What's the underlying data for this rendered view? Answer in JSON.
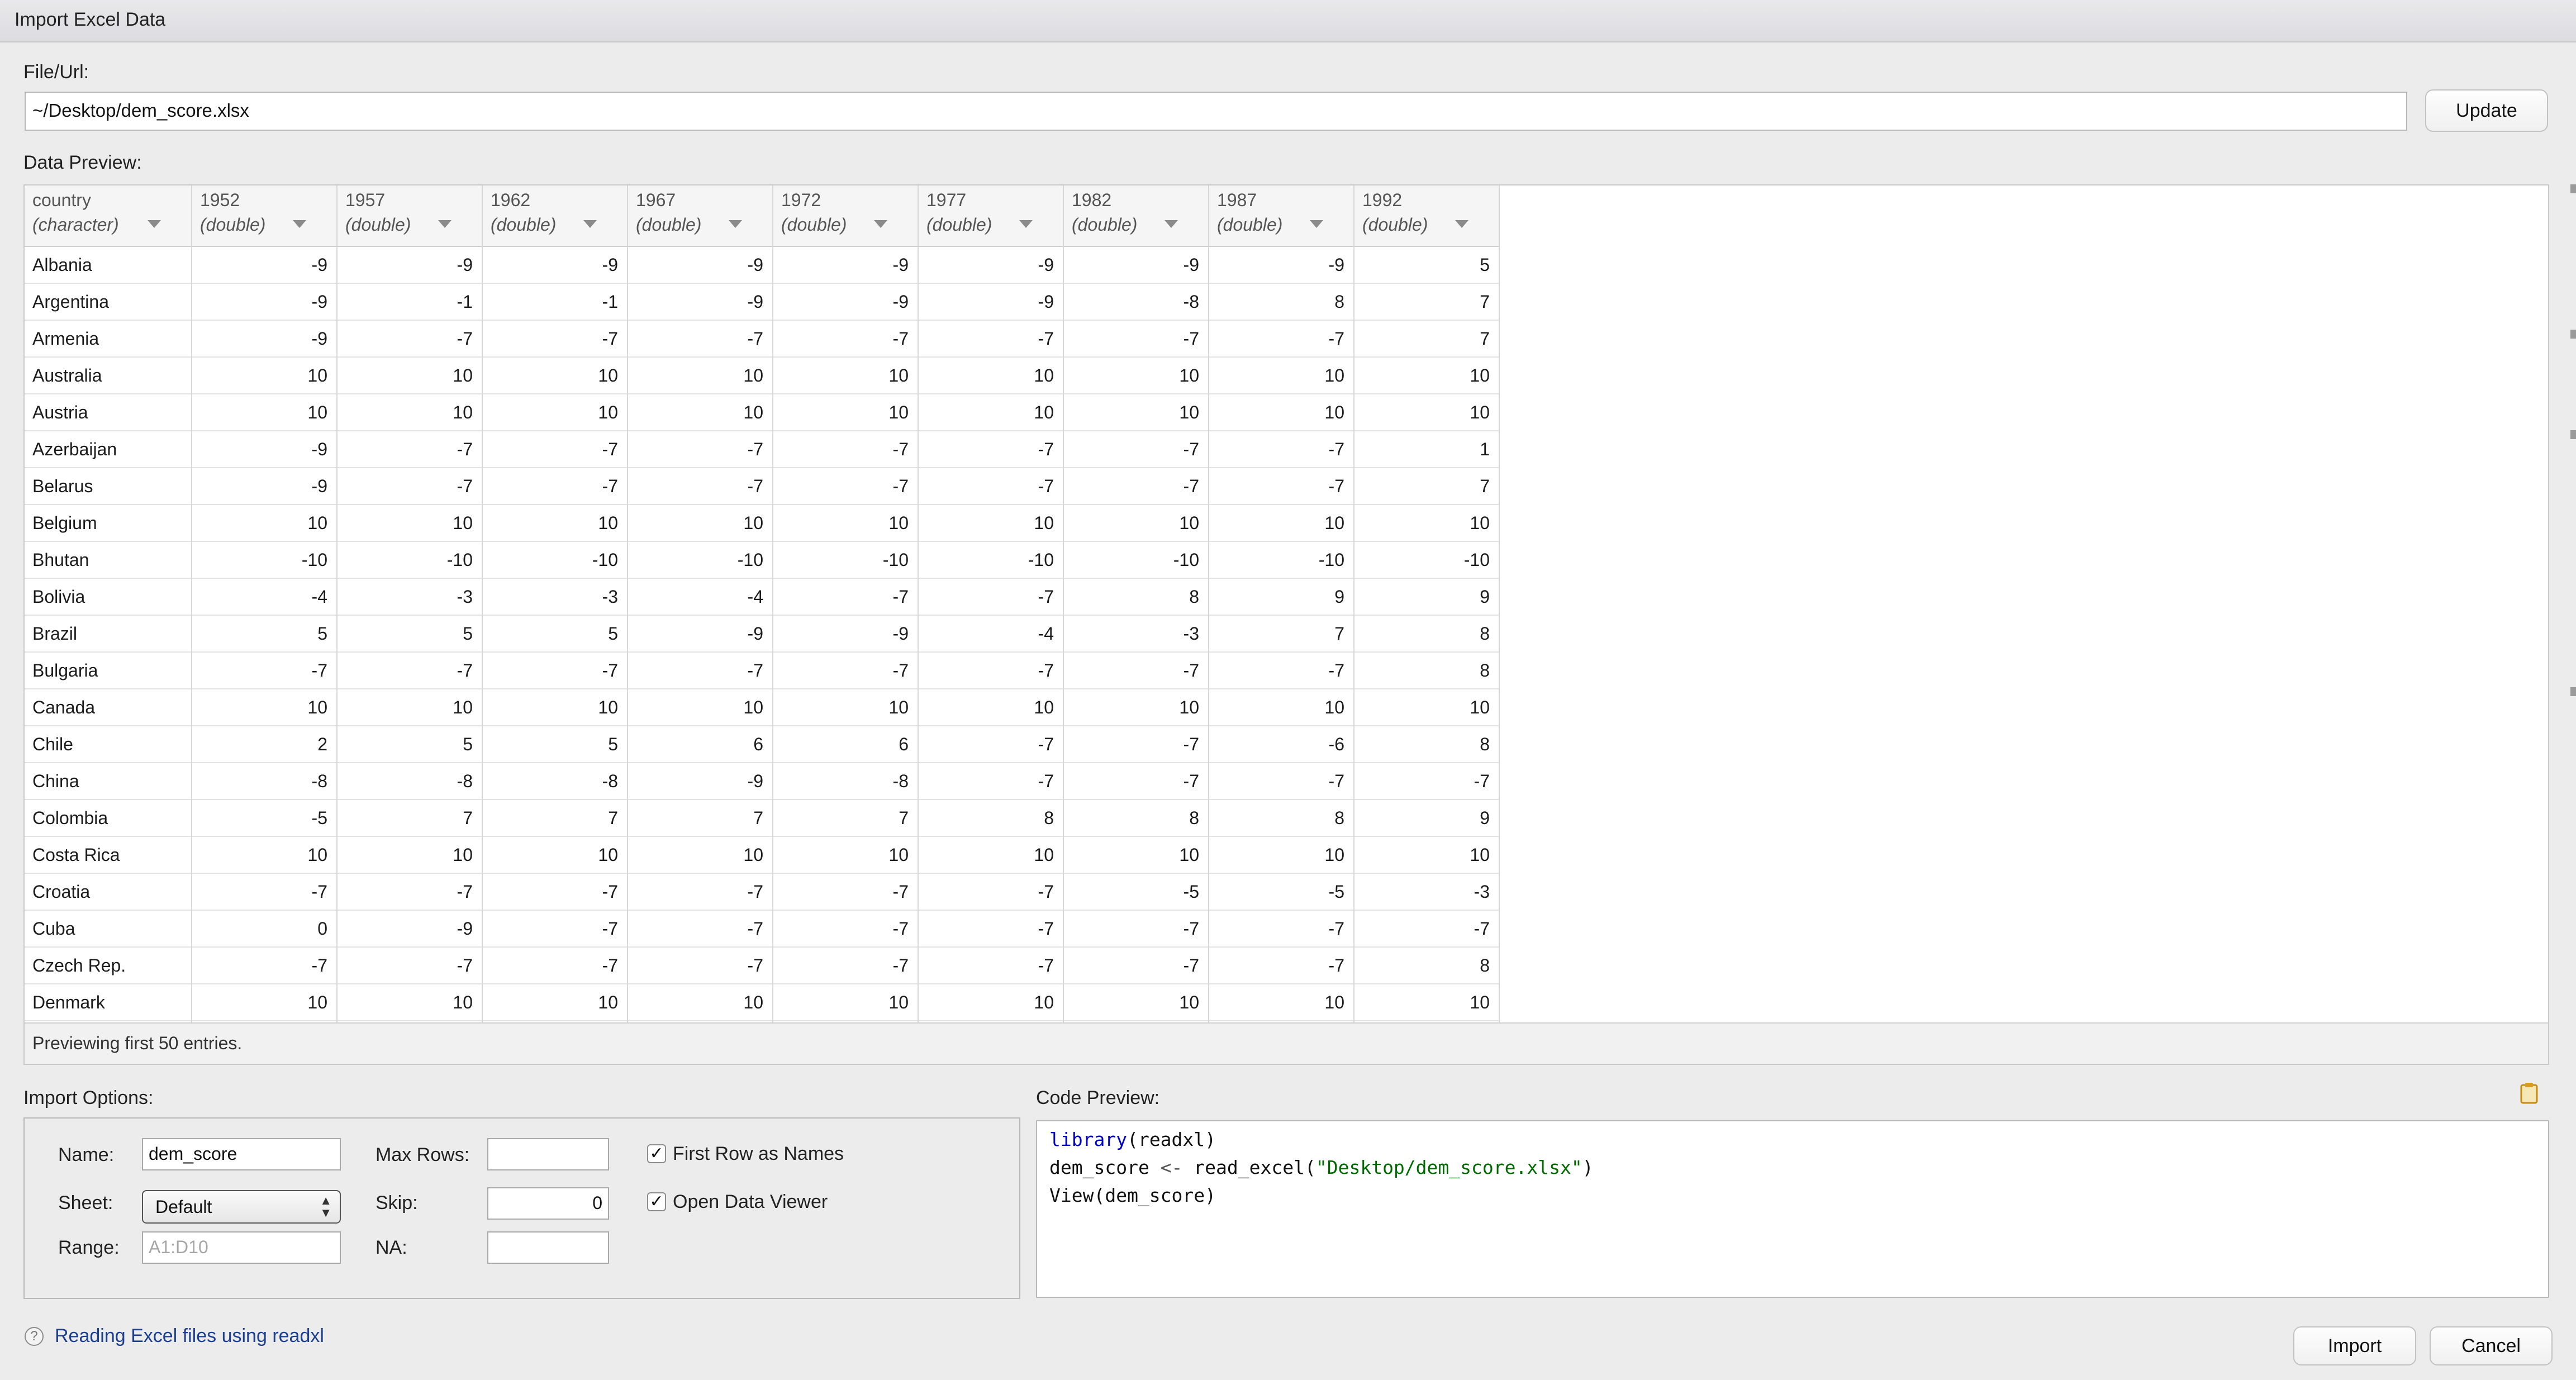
{
  "window": {
    "title": "Import Excel Data"
  },
  "file": {
    "label": "File/Url:",
    "value": "~/Desktop/dem_score.xlsx",
    "update_label": "Update"
  },
  "preview": {
    "label": "Data Preview:",
    "columns": [
      {
        "name": "country",
        "type": "(character)"
      },
      {
        "name": "1952",
        "type": "(double)"
      },
      {
        "name": "1957",
        "type": "(double)"
      },
      {
        "name": "1962",
        "type": "(double)"
      },
      {
        "name": "1967",
        "type": "(double)"
      },
      {
        "name": "1972",
        "type": "(double)"
      },
      {
        "name": "1977",
        "type": "(double)"
      },
      {
        "name": "1982",
        "type": "(double)"
      },
      {
        "name": "1987",
        "type": "(double)"
      },
      {
        "name": "1992",
        "type": "(double)"
      }
    ],
    "rows": [
      [
        "Albania",
        "-9",
        "-9",
        "-9",
        "-9",
        "-9",
        "-9",
        "-9",
        "-9",
        "5"
      ],
      [
        "Argentina",
        "-9",
        "-1",
        "-1",
        "-9",
        "-9",
        "-9",
        "-8",
        "8",
        "7"
      ],
      [
        "Armenia",
        "-9",
        "-7",
        "-7",
        "-7",
        "-7",
        "-7",
        "-7",
        "-7",
        "7"
      ],
      [
        "Australia",
        "10",
        "10",
        "10",
        "10",
        "10",
        "10",
        "10",
        "10",
        "10"
      ],
      [
        "Austria",
        "10",
        "10",
        "10",
        "10",
        "10",
        "10",
        "10",
        "10",
        "10"
      ],
      [
        "Azerbaijan",
        "-9",
        "-7",
        "-7",
        "-7",
        "-7",
        "-7",
        "-7",
        "-7",
        "1"
      ],
      [
        "Belarus",
        "-9",
        "-7",
        "-7",
        "-7",
        "-7",
        "-7",
        "-7",
        "-7",
        "7"
      ],
      [
        "Belgium",
        "10",
        "10",
        "10",
        "10",
        "10",
        "10",
        "10",
        "10",
        "10"
      ],
      [
        "Bhutan",
        "-10",
        "-10",
        "-10",
        "-10",
        "-10",
        "-10",
        "-10",
        "-10",
        "-10"
      ],
      [
        "Bolivia",
        "-4",
        "-3",
        "-3",
        "-4",
        "-7",
        "-7",
        "8",
        "9",
        "9"
      ],
      [
        "Brazil",
        "5",
        "5",
        "5",
        "-9",
        "-9",
        "-4",
        "-3",
        "7",
        "8"
      ],
      [
        "Bulgaria",
        "-7",
        "-7",
        "-7",
        "-7",
        "-7",
        "-7",
        "-7",
        "-7",
        "8"
      ],
      [
        "Canada",
        "10",
        "10",
        "10",
        "10",
        "10",
        "10",
        "10",
        "10",
        "10"
      ],
      [
        "Chile",
        "2",
        "5",
        "5",
        "6",
        "6",
        "-7",
        "-7",
        "-6",
        "8"
      ],
      [
        "China",
        "-8",
        "-8",
        "-8",
        "-9",
        "-8",
        "-7",
        "-7",
        "-7",
        "-7"
      ],
      [
        "Colombia",
        "-5",
        "7",
        "7",
        "7",
        "7",
        "8",
        "8",
        "8",
        "9"
      ],
      [
        "Costa Rica",
        "10",
        "10",
        "10",
        "10",
        "10",
        "10",
        "10",
        "10",
        "10"
      ],
      [
        "Croatia",
        "-7",
        "-7",
        "-7",
        "-7",
        "-7",
        "-7",
        "-5",
        "-5",
        "-3"
      ],
      [
        "Cuba",
        "0",
        "-9",
        "-7",
        "-7",
        "-7",
        "-7",
        "-7",
        "-7",
        "-7"
      ],
      [
        "Czech Rep.",
        "-7",
        "-7",
        "-7",
        "-7",
        "-7",
        "-7",
        "-7",
        "-7",
        "8"
      ],
      [
        "Denmark",
        "10",
        "10",
        "10",
        "10",
        "10",
        "10",
        "10",
        "10",
        "10"
      ]
    ],
    "footer": "Previewing first 50 entries."
  },
  "options": {
    "label": "Import Options:",
    "name_label": "Name:",
    "name_value": "dem_score",
    "sheet_label": "Sheet:",
    "sheet_value": "Default",
    "range_label": "Range:",
    "range_placeholder": "A1:D10",
    "maxrows_label": "Max Rows:",
    "maxrows_value": "",
    "skip_label": "Skip:",
    "skip_value": "0",
    "na_label": "NA:",
    "na_value": "",
    "first_row_label": "First Row as Names",
    "first_row_checked": true,
    "open_viewer_label": "Open Data Viewer",
    "open_viewer_checked": true,
    "check_mark": "✓"
  },
  "code": {
    "label": "Code Preview:",
    "line1_kw": "library",
    "line1_rest": "(readxl)",
    "line2_a": "dem_score ",
    "line2_op": "<-",
    "line2_b": " read_excel(",
    "line2_str": "\"Desktop/dem_score.xlsx\"",
    "line2_c": ")",
    "line3": "View(dem_score)",
    "copy_icon": "clipboard-icon"
  },
  "help": {
    "icon": "?",
    "link": "Reading Excel files using readxl"
  },
  "buttons": {
    "import": "Import",
    "cancel": "Cancel"
  }
}
